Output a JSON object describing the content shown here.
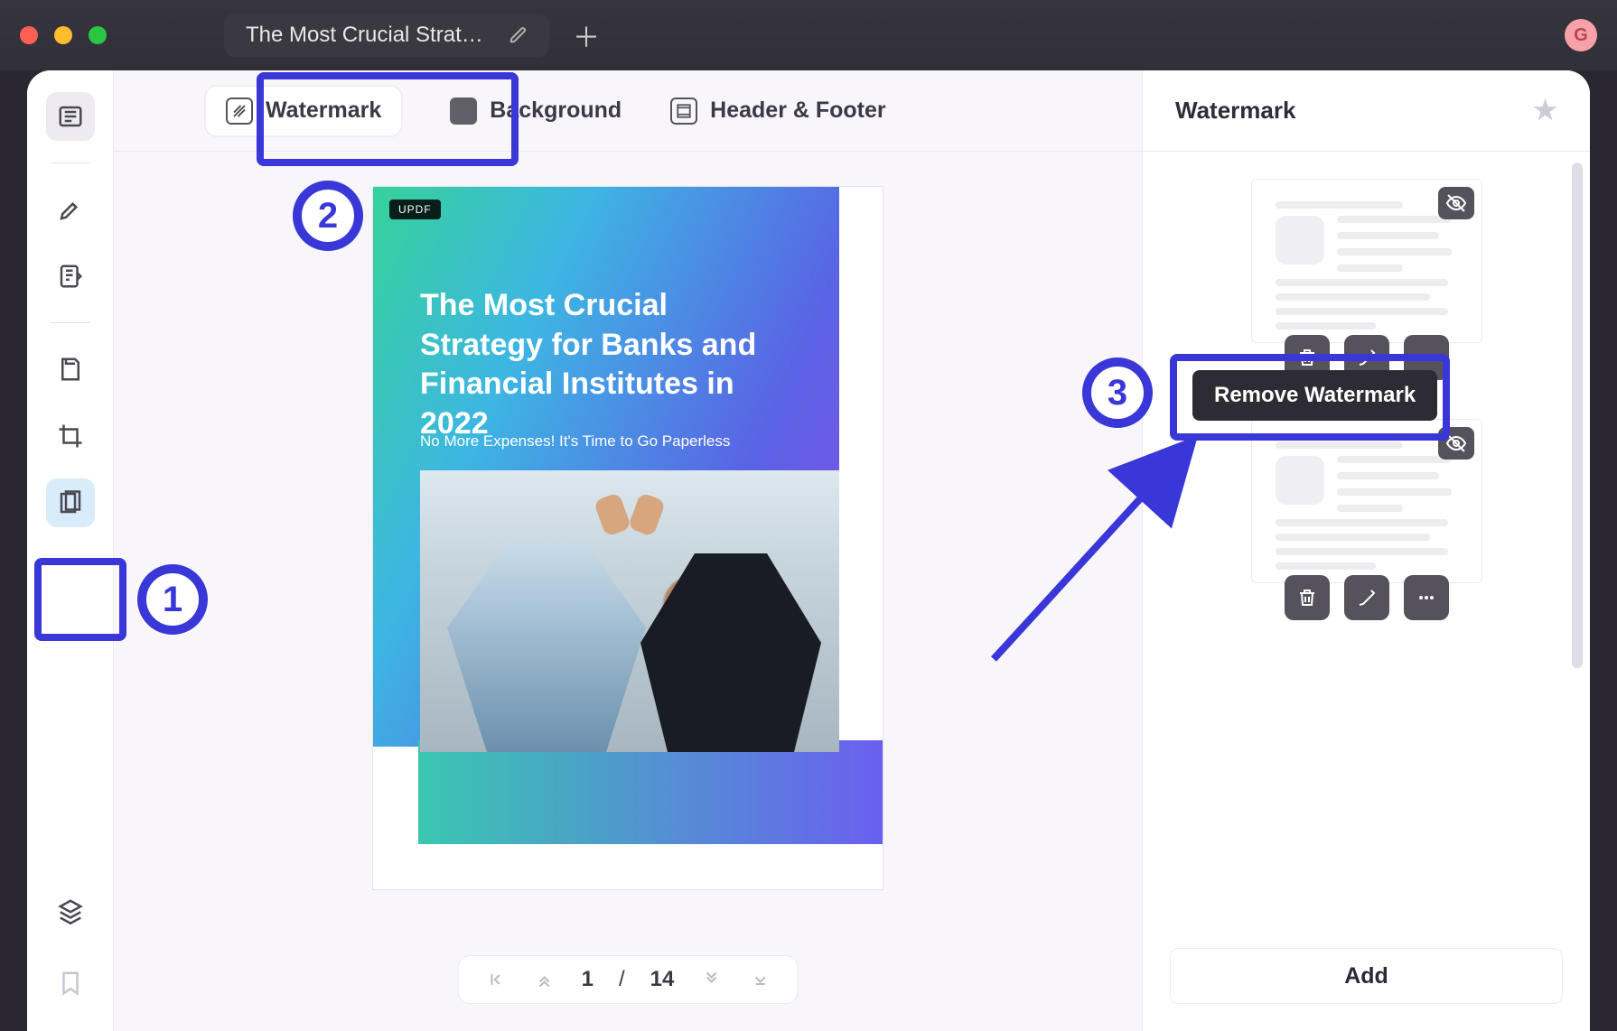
{
  "window": {
    "tab_title": "The Most Crucial Strategy",
    "avatar_letter": "G"
  },
  "left_rail": {
    "icons": [
      "reader-icon",
      "highlighter-icon",
      "annotate-icon",
      "organize-icon",
      "crop-icon",
      "page-tools-icon",
      "layers-icon",
      "bookmark-icon"
    ]
  },
  "topbar": {
    "watermark": "Watermark",
    "background": "Background",
    "header_footer": "Header & Footer"
  },
  "document": {
    "app_logo": "UPDF",
    "title": "The Most Crucial Strategy for Banks and Financial Institutes in 2022",
    "subtitle": "No More Expenses! It's Time to Go Paperless"
  },
  "pager": {
    "current": "1",
    "separator": "/",
    "total": "14"
  },
  "right_panel": {
    "title": "Watermark",
    "tooltip_remove": "Remove Watermark",
    "add": "Add"
  },
  "annotations": {
    "step1": "1",
    "step2": "2",
    "step3": "3"
  }
}
